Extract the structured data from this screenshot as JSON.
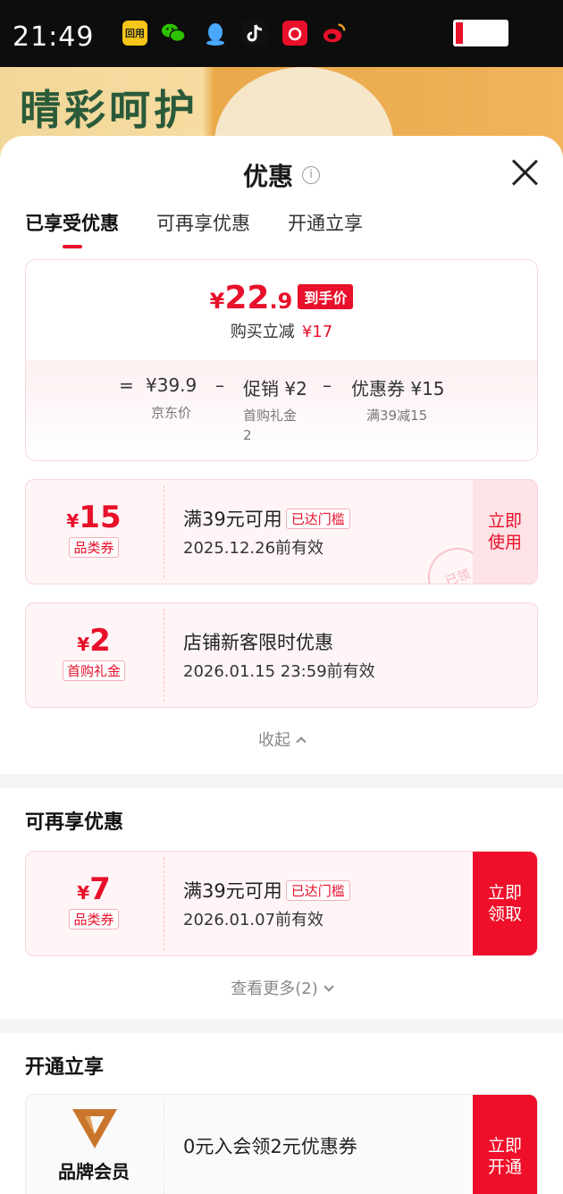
{
  "status_bar": {
    "time": "21:49",
    "apps": [
      {
        "icon": "app-badge-icon",
        "label": "回用",
        "color": "#f5c518"
      },
      {
        "icon": "wechat-icon",
        "label": "",
        "color": "#2dc100"
      },
      {
        "icon": "qq-icon",
        "label": "",
        "color": "#4aa8ff"
      },
      {
        "icon": "tiktok-icon",
        "label": "",
        "color": "#111111"
      },
      {
        "icon": "netease-music-icon",
        "label": "",
        "color": "#e8102a"
      },
      {
        "icon": "weibo-icon",
        "label": "",
        "color": "#e8102a"
      }
    ],
    "battery_level": 0.1
  },
  "banner": {
    "text": "晴彩呵护"
  },
  "sheet": {
    "title": "优惠",
    "info_icon": "ⓘ",
    "tabs": [
      {
        "label": "已享受优惠",
        "active": true
      },
      {
        "label": "可再享优惠",
        "active": false
      },
      {
        "label": "开通立享",
        "active": false
      }
    ]
  },
  "summary": {
    "currency": "¥",
    "price_int": "22",
    "price_dec": ".9",
    "price_tag": "到手价",
    "save_label": "购买立减",
    "save_amount": "¥17",
    "eq": "=",
    "minus": "–",
    "base_price": "¥39.9",
    "base_label": "京东价",
    "promo_price": "促销 ¥2",
    "promo_label_line1": "首购礼金",
    "promo_label_line2": "2",
    "coupon_price": "优惠券 ¥15",
    "coupon_label": "满39减15"
  },
  "coupons_used": [
    {
      "currency": "¥",
      "amount": "15",
      "kind": "品类券",
      "condition": "满39元可用",
      "threshold": "已达门槛",
      "valid": "2025.12.26前有效",
      "action": "立即\n使用",
      "stamp": "已领"
    },
    {
      "currency": "¥",
      "amount": "2",
      "kind": "首购礼金",
      "condition": "店铺新客限时优惠",
      "threshold": "",
      "valid": "2026.01.15 23:59前有效",
      "action": ""
    }
  ],
  "collapse_label": "收起",
  "more_section": {
    "title": "可再享优惠",
    "coupon": {
      "currency": "¥",
      "amount": "7",
      "kind": "品类券",
      "condition": "满39元可用",
      "threshold": "已达门槛",
      "valid": "2026.01.07前有效",
      "action": "立即\n领取"
    },
    "see_more": "查看更多(2)"
  },
  "open_section": {
    "title": "开通立享",
    "member_name": "品牌会员",
    "desc": "0元入会领2元优惠券",
    "action": "立即\n开通"
  },
  "colors": {
    "accent": "#e8102a",
    "soft": "#fde2e6"
  }
}
